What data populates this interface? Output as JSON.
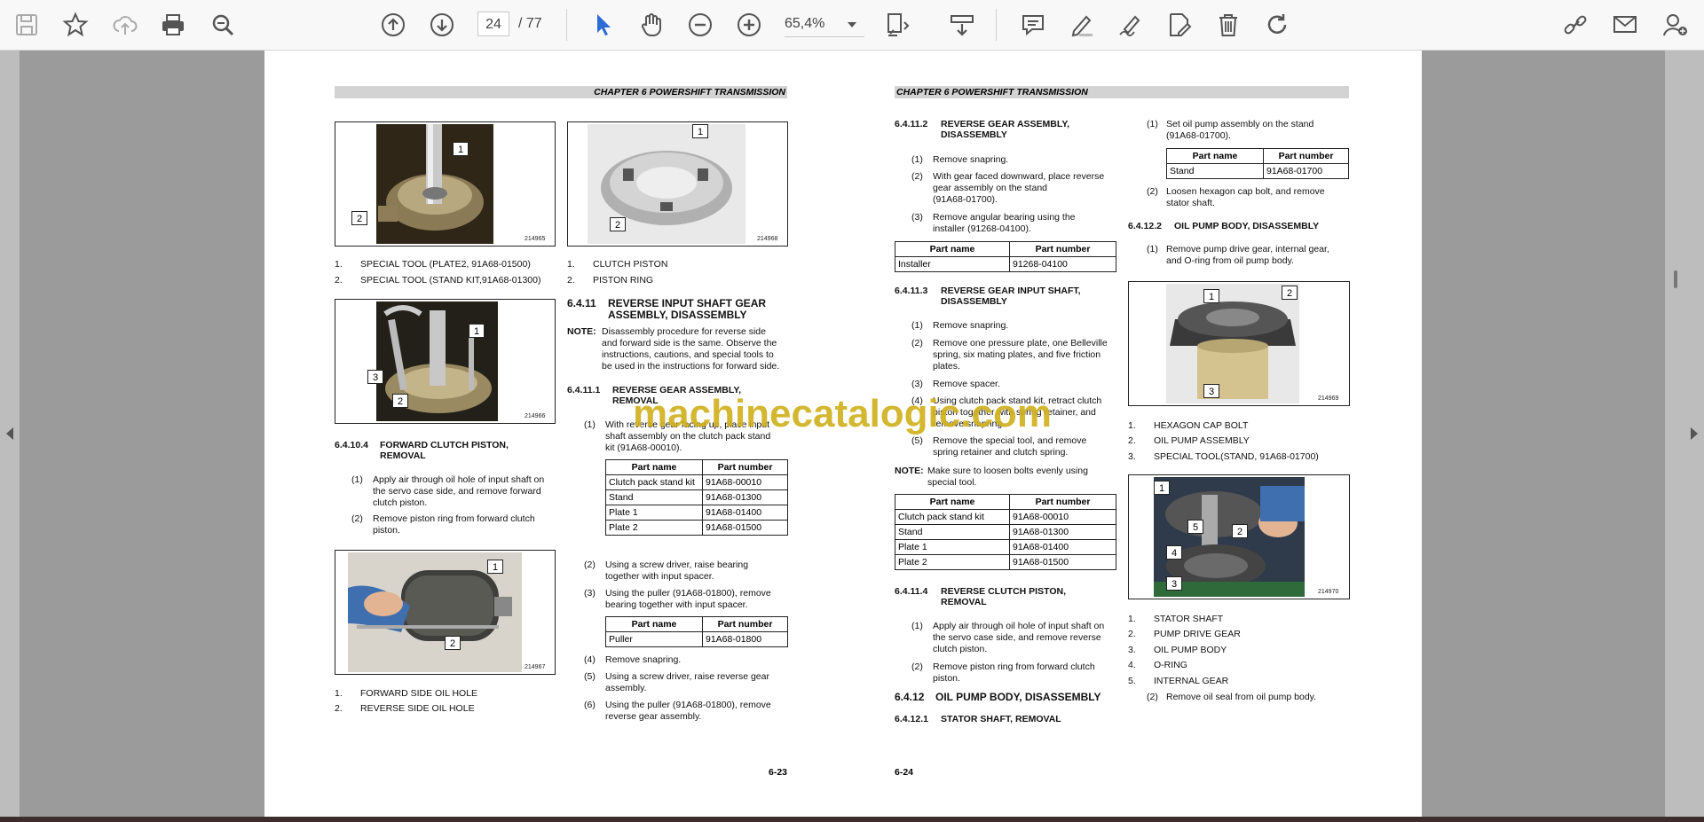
{
  "toolbar": {
    "page_current": "24",
    "page_total": "/ 77",
    "zoom": "65,4%"
  },
  "watermark": "machinecatalogic.com",
  "left_page": {
    "chapter": "CHAPTER 6 POWERSHIFT TRANSMISSION",
    "fig1": {
      "num": "214965",
      "c1": "1",
      "c2": "2"
    },
    "fig2": {
      "num": "214968",
      "c1": "1",
      "c2": "2"
    },
    "fig3": {
      "num": "214966",
      "c1": "1",
      "c2": "2",
      "c3": "3"
    },
    "fig4": {
      "num": "214967",
      "c1": "1",
      "c2": "2"
    },
    "cap1": [
      {
        "n": "1.",
        "t": "SPECIAL TOOL (PLATE2, 91A68-01500)"
      },
      {
        "n": "2.",
        "t": "SPECIAL TOOL (STAND KIT,91A68-01300)"
      }
    ],
    "cap2": [
      {
        "n": "1.",
        "t": "CLUTCH PISTON"
      },
      {
        "n": "2.",
        "t": "PISTON RING"
      }
    ],
    "s6410_4_num": "6.4.10.4",
    "s6410_4_title1": "FORWARD CLUTCH PISTON,",
    "s6410_4_title2": "REMOVAL",
    "s6410_4_steps": [
      {
        "n": "(1)",
        "l1": "Apply air through oil hole of input shaft on",
        "l2": "the servo case side, and remove forward",
        "l3": "clutch piston."
      },
      {
        "n": "(2)",
        "l1": "Remove piston ring from forward clutch",
        "l2": "piston."
      }
    ],
    "cap4": [
      {
        "n": "1.",
        "t": "FORWARD SIDE OIL HOLE"
      },
      {
        "n": "2.",
        "t": "REVERSE SIDE OIL HOLE"
      }
    ],
    "s6411_num": "6.4.11",
    "s6411_title1": "REVERSE INPUT SHAFT GEAR",
    "s6411_title2": "ASSEMBLY, DISASSEMBLY",
    "note_label": "NOTE:",
    "note_lines": [
      "Disassembly procedure for reverse side",
      "and forward side is the same. Observe the",
      "instructions, cautions, and special tools to",
      "be used in the instructions for forward side."
    ],
    "s6411_1_num": "6.4.11.1",
    "s6411_1_title1": "REVERSE GEAR ASSEMBLY,",
    "s6411_1_title2": "REMOVAL",
    "s6411_1_step1": {
      "n": "(1)",
      "l1": "With reverse gear facing up, place input",
      "l2": "shaft assembly on the clutch pack stand",
      "l3": "kit (91A68-00010)."
    },
    "table1": {
      "headers": [
        "Part name",
        "Part number"
      ],
      "rows": [
        [
          "Clutch pack stand kit",
          "91A68-00010"
        ],
        [
          "Stand",
          "91A68-01300"
        ],
        [
          "Plate 1",
          "91A68-01400"
        ],
        [
          "Plate 2",
          "91A68-01500"
        ]
      ]
    },
    "s6411_1_step2": {
      "n": "(2)",
      "l1": "Using a screw driver, raise bearing",
      "l2": "together with input spacer."
    },
    "s6411_1_step3": {
      "n": "(3)",
      "l1": "Using the puller (91A68-01800), remove",
      "l2": "bearing together with input spacer."
    },
    "table2": {
      "headers": [
        "Part name",
        "Part number"
      ],
      "rows": [
        [
          "Puller",
          "91A68-01800"
        ]
      ]
    },
    "s6411_1_step4": {
      "n": "(4)",
      "l1": "Remove snapring."
    },
    "s6411_1_step5": {
      "n": "(5)",
      "l1": "Using a screw driver, raise reverse gear",
      "l2": "assembly."
    },
    "s6411_1_step6": {
      "n": "(6)",
      "l1": "Using the puller (91A68-01800), remove",
      "l2": "reverse gear assembly."
    },
    "page_no": "6-23"
  },
  "right_page": {
    "chapter": "CHAPTER 6 POWERSHIFT TRANSMISSION",
    "s2_num": "6.4.11.2",
    "s2_title1": "REVERSE GEAR ASSEMBLY,",
    "s2_title2": "DISASSEMBLY",
    "s2_steps": [
      {
        "n": "(1)",
        "l1": "Remove snapring."
      },
      {
        "n": "(2)",
        "l1": "With gear faced downward, place reverse",
        "l2": "gear assembly on the stand",
        "l3": "(91A68-01700)."
      },
      {
        "n": "(3)",
        "l1": "Remove angular bearing using the",
        "l2": "installer (91268-04100)."
      }
    ],
    "table_installer": {
      "headers": [
        "Part name",
        "Part number"
      ],
      "rows": [
        [
          "Installer",
          "91268-04100"
        ]
      ]
    },
    "s3_num": "6.4.11.3",
    "s3_title1": "REVERSE GEAR INPUT SHAFT,",
    "s3_title2": "DISASSEMBLY",
    "s3_steps": [
      {
        "n": "(1)",
        "l1": "Remove snapring."
      },
      {
        "n": "(2)",
        "l1": "Remove one pressure plate, one Belleville",
        "l2": "spring, six mating plates, and five friction",
        "l3": "plates."
      },
      {
        "n": "(3)",
        "l1": "Remove spacer."
      },
      {
        "n": "(4)",
        "l1": "Using clutch pack stand kit, retract clutch",
        "l2": "piston together with spring retainer, and",
        "l3": "remove snapring."
      },
      {
        "n": "(5)",
        "l1": "Remove the special tool, and remove",
        "l2": "spring retainer and clutch spring."
      }
    ],
    "note_label": "NOTE:",
    "note_lines": [
      "Make sure to loosen bolts evenly using",
      "special tool."
    ],
    "table_clutch": {
      "headers": [
        "Part name",
        "Part number"
      ],
      "rows": [
        [
          "Clutch pack stand kit",
          "91A68-00010"
        ],
        [
          "Stand",
          "91A68-01300"
        ],
        [
          "Plate 1",
          "91A68-01400"
        ],
        [
          "Plate 2",
          "91A68-01500"
        ]
      ]
    },
    "s4_num": "6.4.11.4",
    "s4_title1": "REVERSE CLUTCH PISTON,",
    "s4_title2": "REMOVAL",
    "s4_steps": [
      {
        "n": "(1)",
        "l1": "Apply air through oil hole of input shaft on",
        "l2": "the servo case side, and remove reverse",
        "l3": "clutch piston."
      },
      {
        "n": "(2)",
        "l1": "Remove piston ring from forward clutch",
        "l2": "piston."
      }
    ],
    "s6412_num": "6.4.12",
    "s6412_title": "OIL PUMP BODY, DISASSEMBLY",
    "s6412_1_num": "6.4.12.1",
    "s6412_1_title": "STATOR SHAFT, REMOVAL",
    "c_step1": {
      "n": "(1)",
      "l1": "Set oil pump assembly on the stand",
      "l2": "(91A68-01700)."
    },
    "table_stand": {
      "headers": [
        "Part name",
        "Part number"
      ],
      "rows": [
        [
          "Stand",
          "91A68-01700"
        ]
      ]
    },
    "c_step2": {
      "n": "(2)",
      "l1": "Loosen hexagon cap bolt, and remove",
      "l2": "stator shaft."
    },
    "s6412_2_num": "6.4.12.2",
    "s6412_2_title": "OIL PUMP BODY, DISASSEMBLY",
    "c_step3": {
      "n": "(1)",
      "l1": "Remove pump drive gear, internal gear,",
      "l2": "and O-ring from oil pump body."
    },
    "fig5": {
      "num": "214969",
      "c1": "1",
      "c2": "2",
      "c3": "3"
    },
    "cap5": [
      {
        "n": "1.",
        "t": "HEXAGON CAP BOLT"
      },
      {
        "n": "2.",
        "t": "OIL PUMP ASSEMBLY"
      },
      {
        "n": "3.",
        "t": "SPECIAL TOOL(STAND, 91A68-01700)"
      }
    ],
    "fig6": {
      "num": "214970",
      "c1": "1",
      "c2": "2",
      "c3": "3",
      "c4": "4",
      "c5": "5"
    },
    "cap6": [
      {
        "n": "1.",
        "t": "STATOR SHAFT"
      },
      {
        "n": "2.",
        "t": "PUMP DRIVE GEAR"
      },
      {
        "n": "3.",
        "t": "OIL PUMP BODY"
      },
      {
        "n": "4.",
        "t": "O-RING"
      },
      {
        "n": "5.",
        "t": "INTERNAL GEAR"
      }
    ],
    "c_step4": {
      "n": "(2)",
      "l1": "Remove oil seal from oil pump body."
    },
    "page_no": "6-24"
  }
}
